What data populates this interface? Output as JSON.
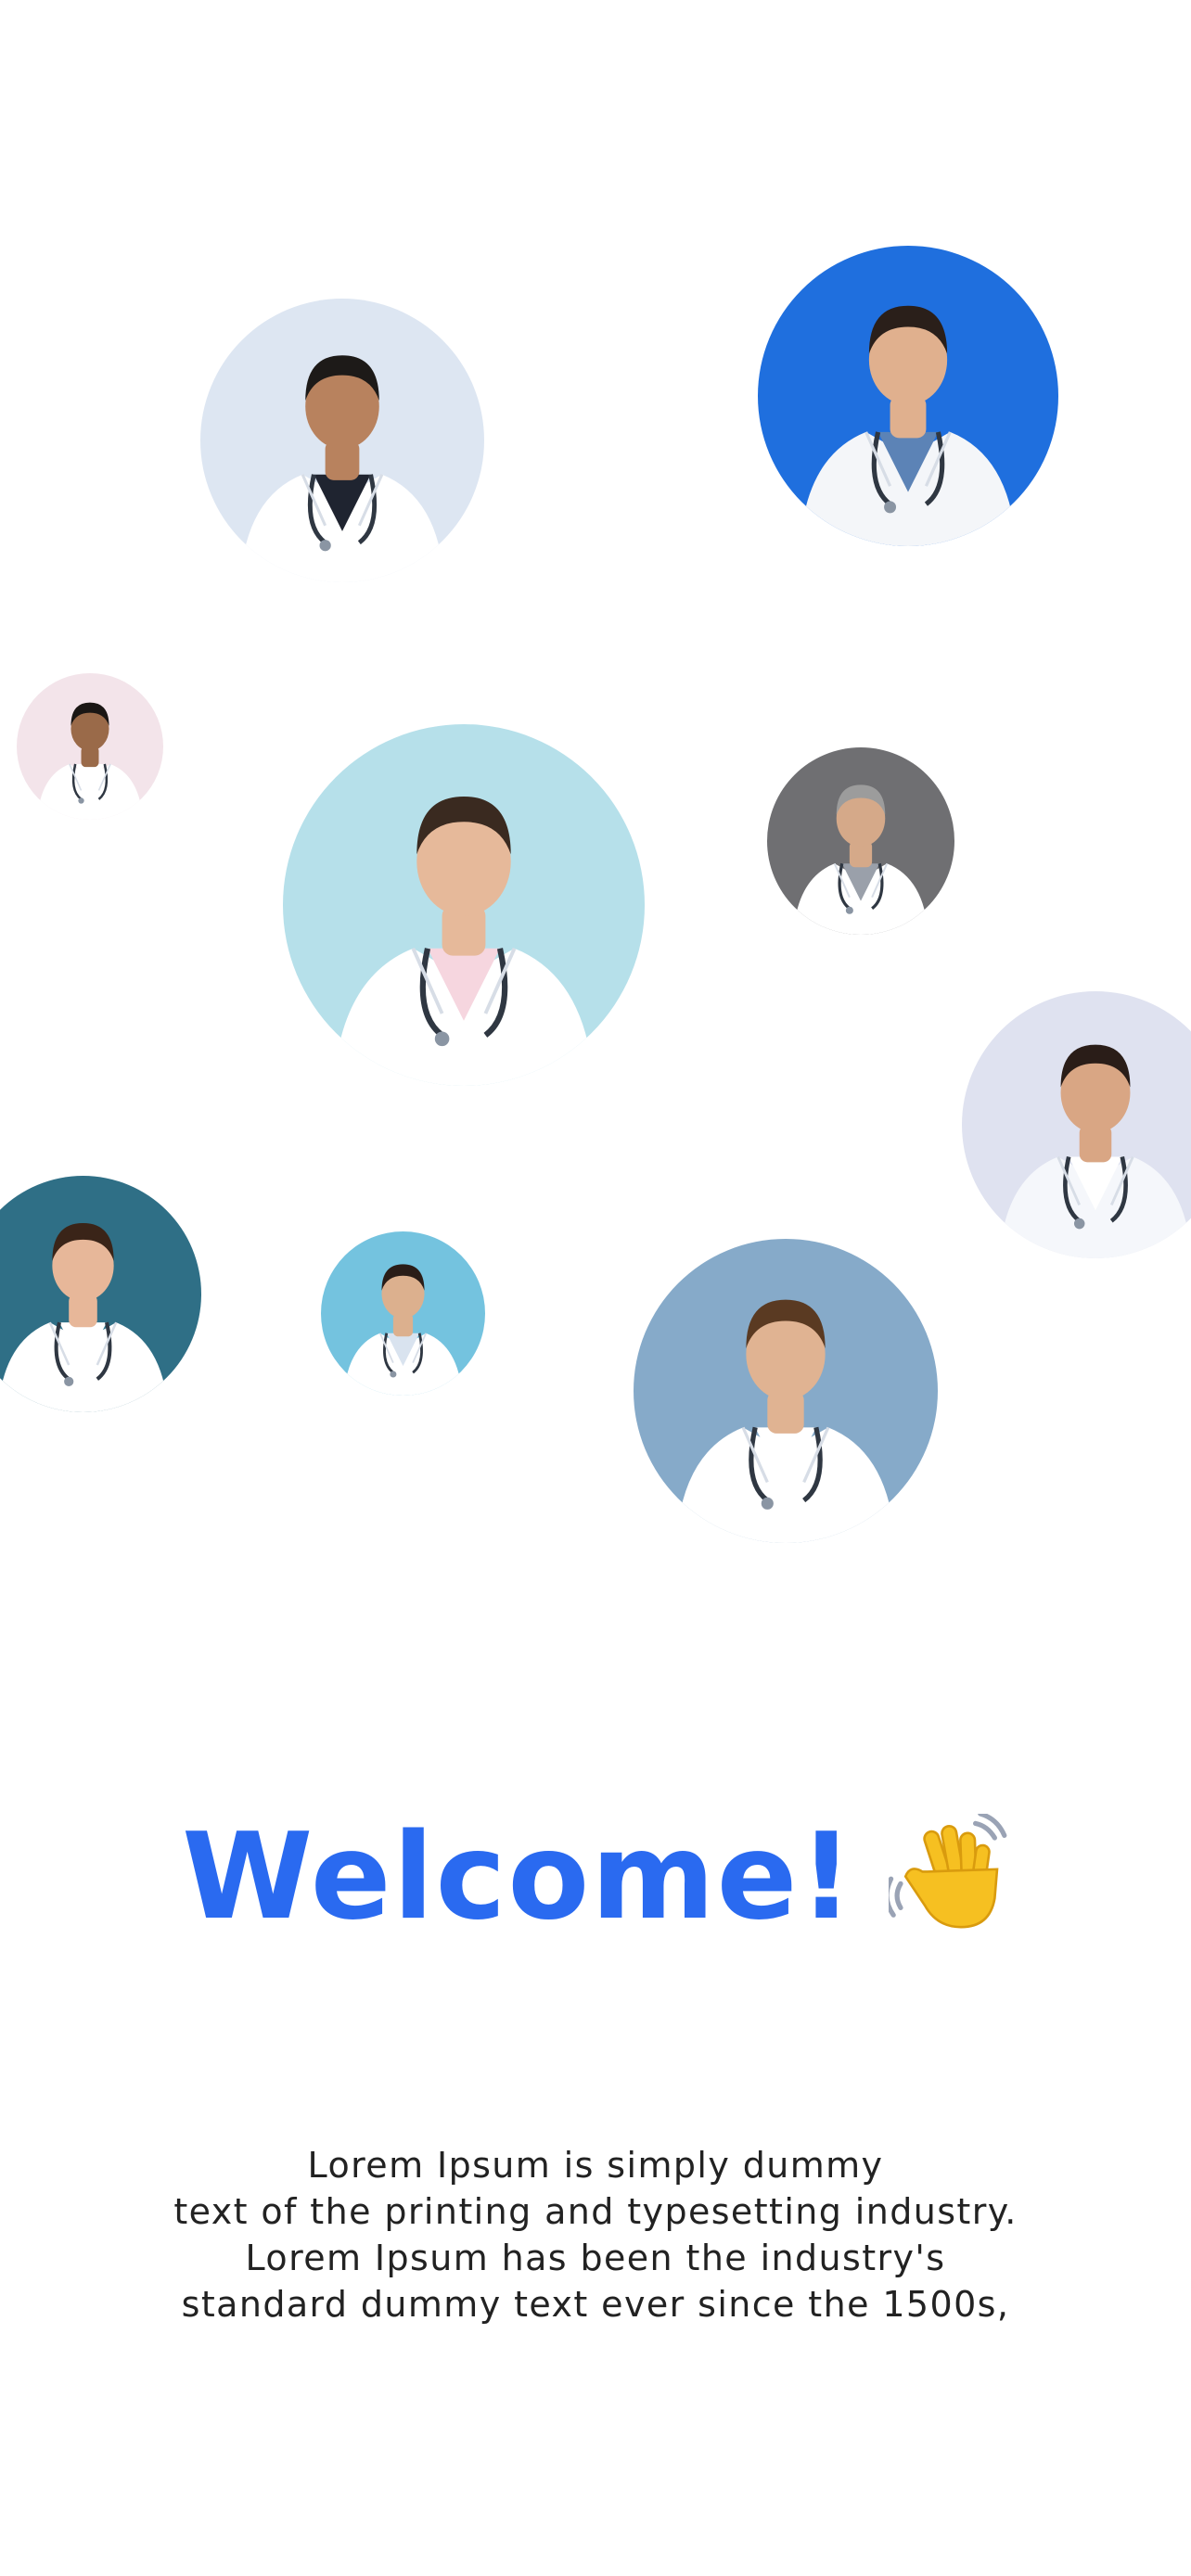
{
  "avatars": [
    {
      "id": "doctor-1",
      "bg": "#dde6f2",
      "coat": "#ffffff",
      "shirt": "#1f2430",
      "skin": "#b8825e",
      "hair": "#1d1a18"
    },
    {
      "id": "doctor-2",
      "bg": "#1f6fde",
      "coat": "#f4f6f9",
      "shirt": "#5c83b6",
      "skin": "#e0b08e",
      "hair": "#2a1f1a"
    },
    {
      "id": "doctor-3",
      "bg": "#f3e4ea",
      "coat": "#ffffff",
      "shirt": "#ffffff",
      "skin": "#9a6a49",
      "hair": "#1a1614"
    },
    {
      "id": "doctor-4",
      "bg": "#b6e0ea",
      "coat": "#ffffff",
      "shirt": "#f6d6df",
      "skin": "#e6b99a",
      "hair": "#3a2a20"
    },
    {
      "id": "doctor-5",
      "bg": "#6f6f72",
      "coat": "#ffffff",
      "shirt": "#9aa0aa",
      "skin": "#d5a989",
      "hair": "#9c9c9c"
    },
    {
      "id": "doctor-6",
      "bg": "#dfe2f0",
      "coat": "#f5f7fb",
      "shirt": "#ffffff",
      "skin": "#d9a684",
      "hair": "#2a1d18"
    },
    {
      "id": "doctor-7",
      "bg": "#2f6f86",
      "coat": "#ffffff",
      "shirt": "#ffffff",
      "skin": "#e7b799",
      "hair": "#3a2418"
    },
    {
      "id": "doctor-8",
      "bg": "#74c3df",
      "coat": "#ffffff",
      "shirt": "#d9e3ef",
      "skin": "#dcb08e",
      "hair": "#2a1d18"
    },
    {
      "id": "doctor-9",
      "bg": "#86aac9",
      "coat": "#ffffff",
      "shirt": "#ffffff",
      "skin": "#e0b392",
      "hair": "#5a3a22"
    }
  ],
  "welcome": {
    "title": "Welcome!",
    "emoji_icon": "waving-hand-icon",
    "color": "#2a6af0"
  },
  "intro": {
    "lines": [
      "Lorem Ipsum is simply dummy",
      "text of the printing and typesetting industry.",
      "Lorem Ipsum has been the industry's",
      "standard dummy text ever since the 1500s,"
    ]
  }
}
